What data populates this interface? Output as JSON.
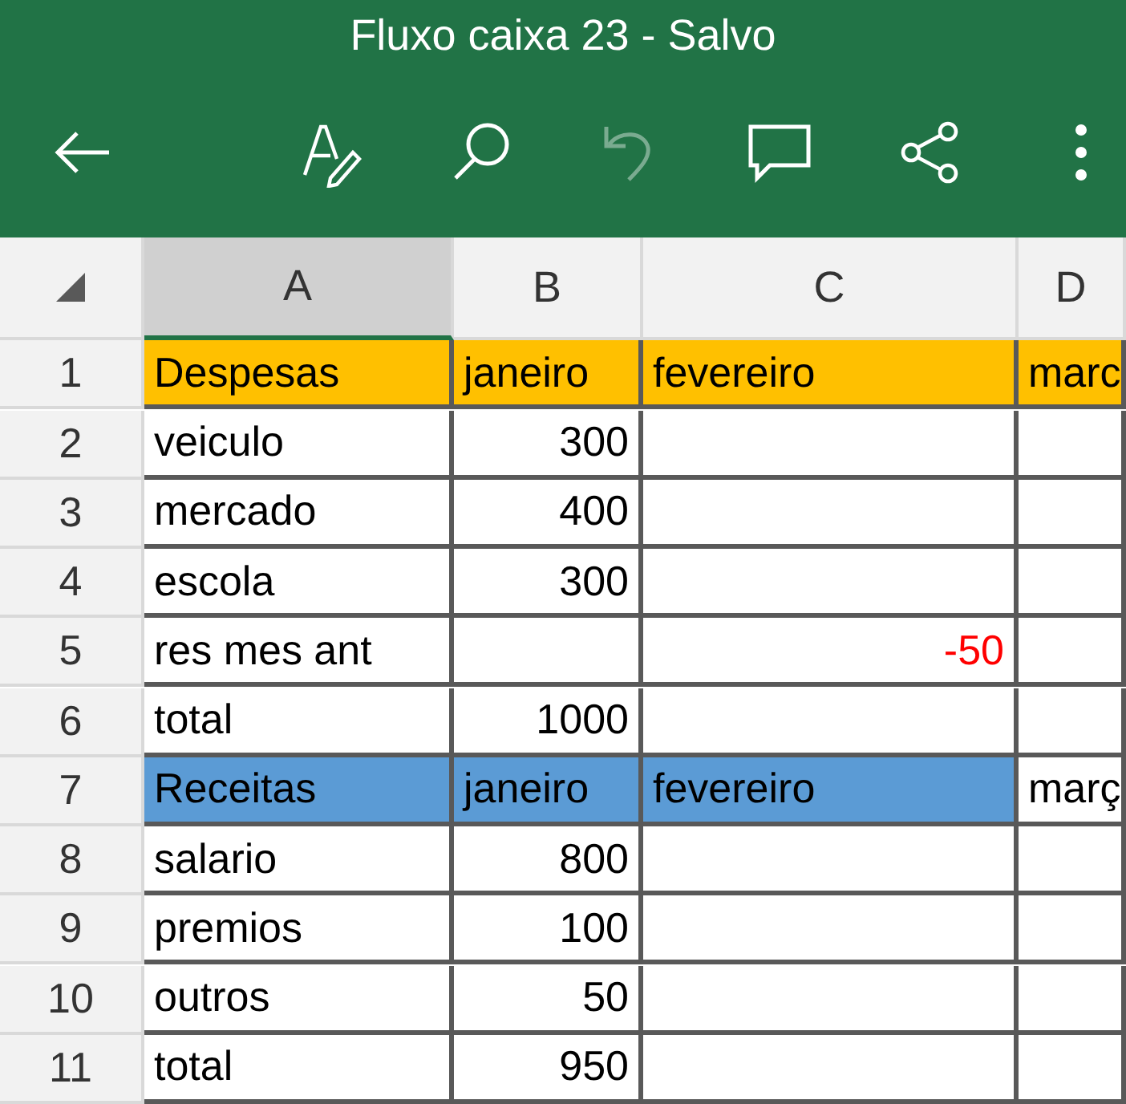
{
  "window": {
    "title": "Fluxo caixa 23 - Salvo"
  },
  "toolbar": [
    {
      "kind": "back",
      "disabled": false
    },
    {
      "kind": "edit",
      "disabled": false
    },
    {
      "kind": "search",
      "disabled": false
    },
    {
      "kind": "undo",
      "disabled": true
    },
    {
      "kind": "comment",
      "disabled": false
    },
    {
      "kind": "share",
      "disabled": false
    },
    {
      "kind": "more",
      "disabled": false
    }
  ],
  "columns": [
    {
      "label": "A",
      "selected": true
    },
    {
      "label": "B",
      "selected": false
    },
    {
      "label": "C",
      "selected": false
    },
    {
      "label": "D",
      "selected": false
    }
  ],
  "rows": [
    {
      "number": "1",
      "cells": [
        {
          "kind": "text",
          "text": "Despesas",
          "color": "#ffc000"
        },
        {
          "kind": "text",
          "text": "janeiro",
          "color": "#ffc000"
        },
        {
          "kind": "text",
          "text": "fevereiro",
          "color": "#ffc000"
        },
        {
          "kind": "text",
          "text": "marc",
          "color": "#ffc000"
        }
      ]
    },
    {
      "number": "2",
      "cells": [
        {
          "kind": "text",
          "text": "veiculo"
        },
        {
          "kind": "number",
          "text": "300"
        },
        {
          "kind": "text"
        },
        {
          "kind": "text"
        }
      ]
    },
    {
      "number": "3",
      "cells": [
        {
          "kind": "text",
          "text": "mercado"
        },
        {
          "kind": "number",
          "text": "400"
        },
        {
          "kind": "text"
        },
        {
          "kind": "text"
        }
      ]
    },
    {
      "number": "4",
      "cells": [
        {
          "kind": "text",
          "text": "escola"
        },
        {
          "kind": "number",
          "text": "300"
        },
        {
          "kind": "text"
        },
        {
          "kind": "text"
        }
      ]
    },
    {
      "number": "5",
      "cells": [
        {
          "kind": "text",
          "text": "res mes ant"
        },
        {
          "kind": "text"
        },
        {
          "kind": "number",
          "text": "-50",
          "negative": true
        },
        {
          "kind": "text"
        }
      ]
    },
    {
      "number": "6",
      "cells": [
        {
          "kind": "text",
          "text": "total"
        },
        {
          "kind": "number",
          "text": "1000"
        },
        {
          "kind": "text"
        },
        {
          "kind": "text"
        }
      ]
    },
    {
      "number": "7",
      "cells": [
        {
          "kind": "text",
          "text": "Receitas",
          "color": "#5b9bd5"
        },
        {
          "kind": "text",
          "text": "janeiro",
          "color": "#5b9bd5"
        },
        {
          "kind": "text",
          "text": "fevereiro",
          "color": "#5b9bd5"
        },
        {
          "kind": "text",
          "text": "març"
        }
      ]
    },
    {
      "number": "8",
      "cells": [
        {
          "kind": "text",
          "text": "salario"
        },
        {
          "kind": "number",
          "text": "800"
        },
        {
          "kind": "text"
        },
        {
          "kind": "text"
        }
      ]
    },
    {
      "number": "9",
      "cells": [
        {
          "kind": "text",
          "text": "premios"
        },
        {
          "kind": "number",
          "text": "100"
        },
        {
          "kind": "text"
        },
        {
          "kind": "text"
        }
      ]
    },
    {
      "number": "10",
      "cells": [
        {
          "kind": "text",
          "text": "outros"
        },
        {
          "kind": "number",
          "text": "50"
        },
        {
          "kind": "text"
        },
        {
          "kind": "text"
        }
      ]
    },
    {
      "number": "11",
      "cells": [
        {
          "kind": "text",
          "text": "total"
        },
        {
          "kind": "number",
          "text": "950"
        },
        {
          "kind": "text"
        },
        {
          "kind": "text"
        }
      ]
    }
  ]
}
